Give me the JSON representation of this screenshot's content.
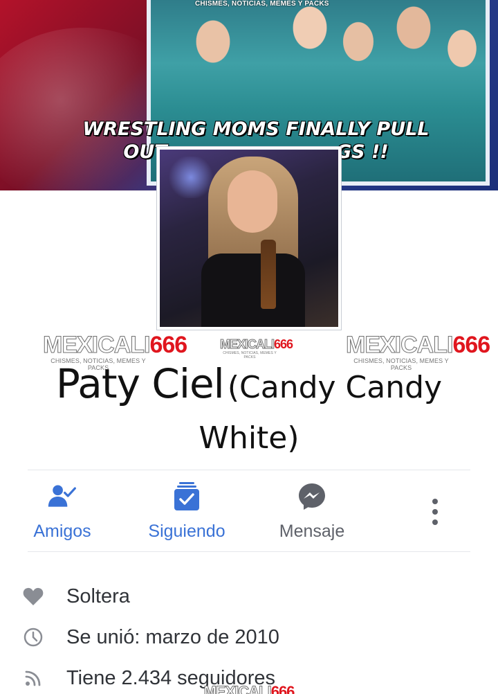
{
  "cover": {
    "watermark": "CHISMES, NOTICIAS, MEMES Y PACKS",
    "headline_line1": "WRESTLING MOMS FINALLY PULL",
    "headline_line2": "OUT                          GS !!"
  },
  "watermark_logo": {
    "left": "MEXICALI",
    "right": "666",
    "tagline": "CHISMES, NOTICIAS, MEMES Y PACKS"
  },
  "profile": {
    "name": "Paty Ciel",
    "alternate_name": "(Candy Candy White)"
  },
  "actions": {
    "friends_label": "Amigos",
    "following_label": "Siguiendo",
    "message_label": "Mensaje",
    "accent_color": "#3a72d6"
  },
  "about": [
    {
      "icon": "heart-icon",
      "text": "Soltera"
    },
    {
      "icon": "clock-icon",
      "text": "Se unió: marzo de 2010"
    },
    {
      "icon": "rss-icon",
      "text": "Tiene 2.434 seguidores"
    }
  ]
}
